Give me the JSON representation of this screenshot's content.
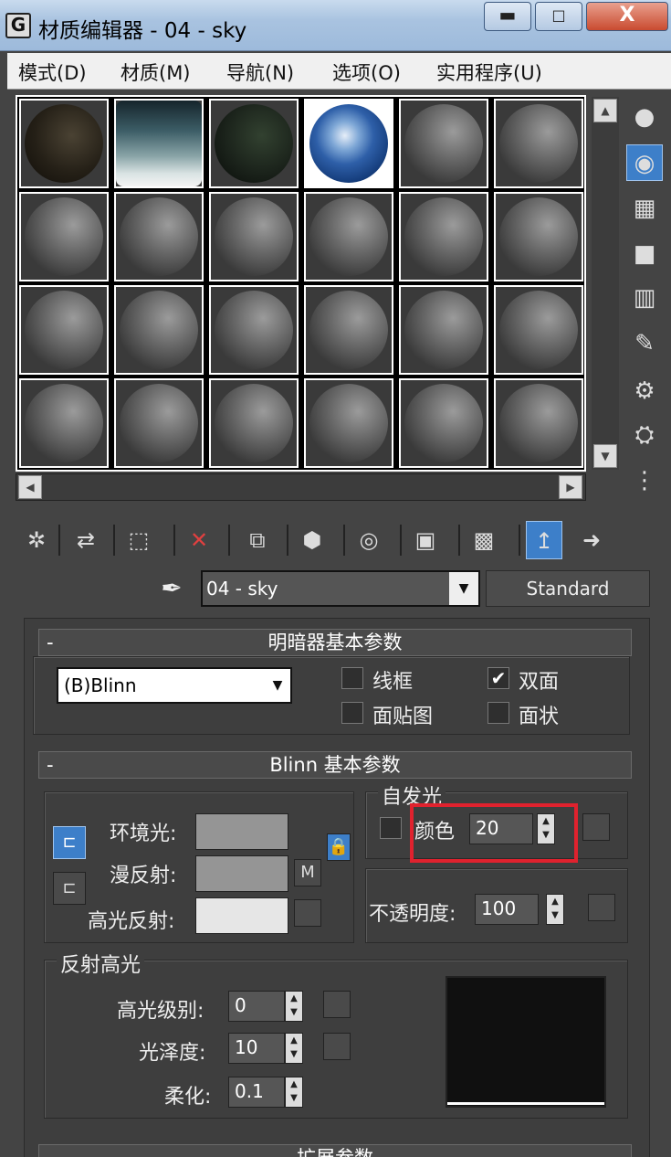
{
  "window": {
    "title": "材质编辑器 - 04 - sky",
    "app_icon": "G",
    "min": "▬",
    "max": "□",
    "close": "X"
  },
  "menu": [
    "模式(D)",
    "材质(M)",
    "导航(N)",
    "选项(O)",
    "实用程序(U)"
  ],
  "slots": {
    "rows": 4,
    "cols": 6,
    "active_index": 3,
    "special": {
      "0": "dark",
      "1": "sky",
      "2": "night",
      "3": "earth"
    }
  },
  "scroll": {
    "up": "▲",
    "down": "▼",
    "left": "◀",
    "right": "▶"
  },
  "side_icons": [
    "sample-type-icon",
    "backlight-icon",
    "background-icon",
    "uv-tiling-icon",
    "video-color-check-icon",
    "make-preview-icon",
    "options-icon",
    "select-by-material-icon",
    "material-map-navigator-icon"
  ],
  "side_glyphs": [
    "●",
    "◉",
    "▦",
    "■",
    "▥",
    "✎",
    "⚙",
    "⛭",
    "⋮"
  ],
  "toolbar_icons": [
    "get-material-icon",
    "put-to-scene-icon",
    "assign-to-selection-icon",
    "reset-icon",
    "make-unique-icon",
    "put-to-library-icon",
    "material-effects-icon",
    "show-map-icon",
    "show-end-result-icon",
    "go-to-parent-icon",
    "go-forward-sibling-icon"
  ],
  "toolbar_glyphs": [
    "✲",
    "⇄",
    "⬚",
    "✕",
    "⧉",
    "⬢",
    "◎",
    "▣",
    "▩",
    "↥",
    "➜"
  ],
  "material": {
    "name": "04 - sky",
    "type": "Standard",
    "eyedropper": "✒"
  },
  "shader_basic": {
    "header": "明暗器基本参数",
    "shader": "(B)Blinn",
    "wire": {
      "label": "线框",
      "checked": false
    },
    "two_sided": {
      "label": "双面",
      "checked": true
    },
    "face_map": {
      "label": "面贴图",
      "checked": false
    },
    "faceted": {
      "label": "面状",
      "checked": false
    }
  },
  "blinn_basic": {
    "header": "Blinn 基本参数",
    "ambient_label": "环境光:",
    "diffuse_label": "漫反射:",
    "specular_label": "高光反射:",
    "m_button": "M",
    "self_illum": {
      "group": "自发光",
      "color_label": "颜色",
      "value": "20"
    },
    "opacity": {
      "label": "不透明度:",
      "value": "100"
    },
    "colors": {
      "ambient": "#959595",
      "diffuse": "#959595",
      "specular": "#e6e6e6"
    }
  },
  "spec_highlights": {
    "group": "反射高光",
    "level": {
      "label": "高光级别:",
      "value": "0"
    },
    "glossiness": {
      "label": "光泽度:",
      "value": "10"
    },
    "soften": {
      "label": "柔化:",
      "value": "0.1"
    }
  },
  "extended": {
    "header": "扩展参数"
  },
  "collapse_minus": "-",
  "check_mark": "✔"
}
